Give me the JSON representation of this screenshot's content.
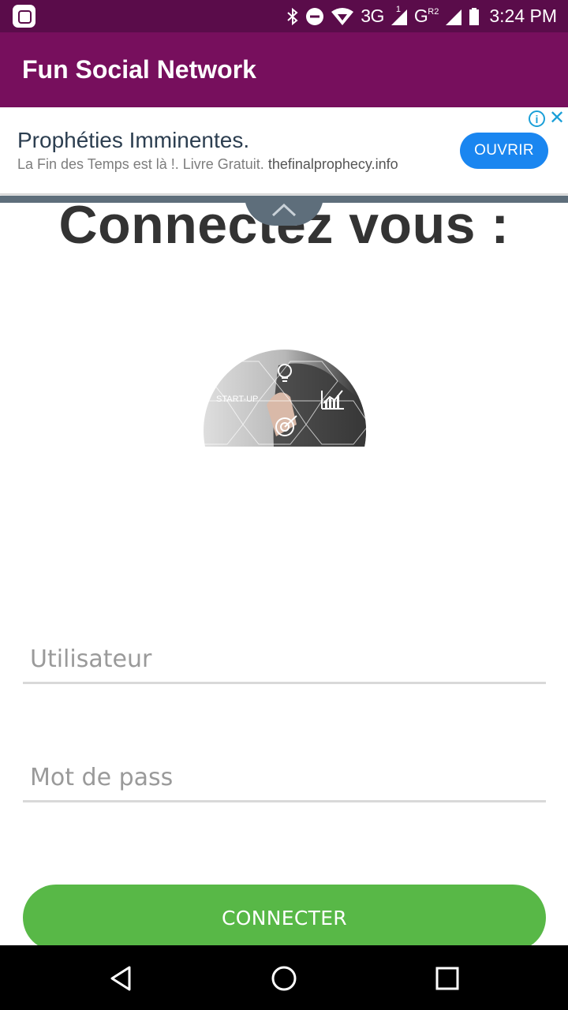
{
  "status_bar": {
    "network_3g": "3G",
    "network_g": "G",
    "sim1_marker": "1",
    "sim2_marker": "R",
    "sim2_index": "2",
    "time": "3:24 PM",
    "icons": [
      "bluetooth-icon",
      "do-not-disturb-icon",
      "wifi-icon",
      "signal-icon",
      "battery-icon"
    ]
  },
  "app_bar": {
    "title": "Fun Social Network"
  },
  "ad": {
    "title": "Prophéties Imminentes.",
    "subtitle": "La Fin des Temps est là !. Livre Gratuit.",
    "domain": "thefinalprophecy.info",
    "cta_label": "OUVRIR"
  },
  "login": {
    "heading": "Connectez vous :",
    "illustration_label": "START-UP",
    "username_placeholder": "Utilisateur",
    "password_placeholder": "Mot de pass",
    "submit_label": "CONNECTER"
  },
  "colors": {
    "status_bar": "#5a0c4a",
    "app_bar": "#770f5d",
    "ad_button": "#1a86f0",
    "submit_button": "#58b847"
  }
}
